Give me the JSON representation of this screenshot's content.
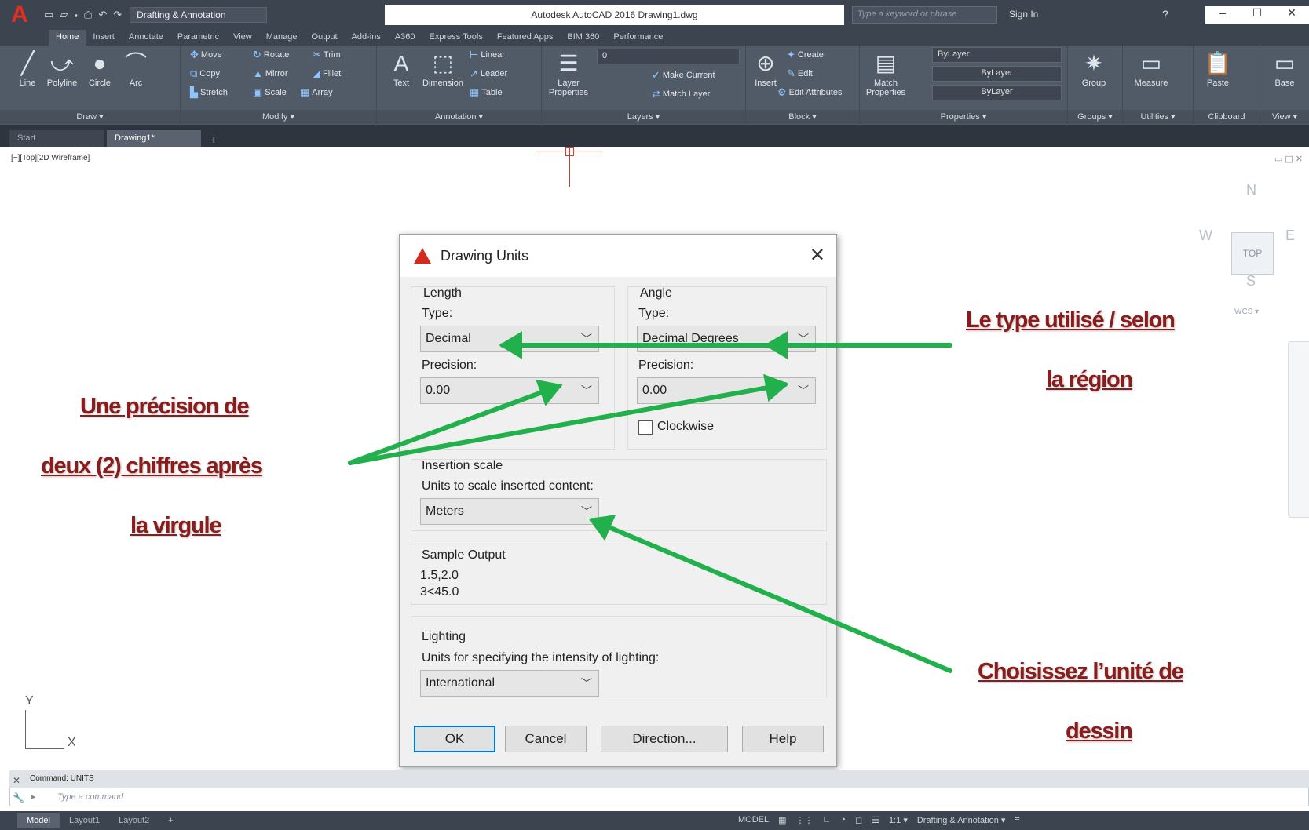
{
  "app": {
    "logo": "A",
    "title": "Autodesk AutoCAD 2016   Drawing1.dwg",
    "workspace": "Drafting & Annotation",
    "search_placeholder": "Type a keyword or phrase",
    "signin": "Sign In",
    "window_controls": [
      "–",
      "☐",
      "✕"
    ]
  },
  "ribbon_tabs": [
    "Home",
    "Insert",
    "Annotate",
    "Parametric",
    "View",
    "Manage",
    "Output",
    "Add-ins",
    "A360",
    "Express Tools",
    "Featured Apps",
    "BIM 360",
    "Performance"
  ],
  "ribbon": {
    "draw": {
      "tools": [
        "Line",
        "Polyline",
        "Circle",
        "Arc"
      ],
      "title": "Draw ▾"
    },
    "modify": {
      "tools": [
        "Move",
        "Rotate",
        "Trim",
        "Copy",
        "Mirror",
        "Fillet",
        "Stretch",
        "Scale",
        "Array"
      ],
      "title": "Modify ▾"
    },
    "annotation": {
      "tools": [
        "Text",
        "Dimension",
        "Linear",
        "Leader",
        "Table"
      ],
      "title": "Annotation ▾"
    },
    "layers": {
      "tools": [
        "Layer Properties",
        "Make Current",
        "Match Layer"
      ],
      "layer_value": "0",
      "title": "Layers ▾"
    },
    "block": {
      "tools": [
        "Insert",
        "Create",
        "Edit",
        "Edit Attributes"
      ],
      "title": "Block ▾"
    },
    "properties": {
      "tools": [
        "Match Properties"
      ],
      "color": "ByLayer",
      "linetype": "ByLayer",
      "lineweight": "ByLayer",
      "title": "Properties ▾"
    },
    "groups": {
      "tools": [
        "Group"
      ],
      "title": "Groups ▾"
    },
    "utilities": {
      "tools": [
        "Measure"
      ],
      "title": "Utilities ▾"
    },
    "clipboard": {
      "tools": [
        "Paste"
      ],
      "title": "Clipboard"
    },
    "view": {
      "tools": [
        "Base"
      ],
      "title": "View ▾"
    }
  },
  "file_tabs": [
    "Start",
    "Drawing1*"
  ],
  "viewport": {
    "label": "[−][Top][2D Wireframe]",
    "viewcube": {
      "top": "TOP",
      "n": "N",
      "s": "S",
      "w": "W",
      "e": "E",
      "wcs": "WCS ▾"
    },
    "ucs": {
      "x": "X",
      "y": "Y"
    }
  },
  "annotations": {
    "left": [
      "Une  précision de",
      "deux  (2) chiffres  après",
      "la virgule"
    ],
    "top_right": [
      "Le type utilisé / selon",
      "la région"
    ],
    "bottom_right": [
      "Choisissez l’unité de",
      "dessin"
    ]
  },
  "dialog": {
    "title": "Drawing Units",
    "close": "✕",
    "length": {
      "group": "Length",
      "type_label": "Type:",
      "type_value": "Decimal",
      "precision_label": "Precision:",
      "precision_value": "0.00"
    },
    "angle": {
      "group": "Angle",
      "type_label": "Type:",
      "type_value": "Decimal Degrees",
      "precision_label": "Precision:",
      "precision_value": "0.00",
      "clockwise_label": "Clockwise",
      "clockwise_checked": false
    },
    "insertion": {
      "group": "Insertion scale",
      "label": "Units to scale inserted content:",
      "value": "Meters"
    },
    "sample": {
      "group": "Sample Output",
      "line1": "1.5,2.0",
      "line2": "3<45.0"
    },
    "lighting": {
      "group": "Lighting",
      "label": "Units for specifying the intensity of lighting:",
      "value": "International"
    },
    "buttons": {
      "ok": "OK",
      "cancel": "Cancel",
      "direction": "Direction...",
      "help": "Help"
    }
  },
  "command": {
    "history": "Command:  UNITS",
    "placeholder": "Type  a  command"
  },
  "status": {
    "layout_tabs": [
      "Model",
      "Layout1",
      "Layout2"
    ],
    "model": "MODEL",
    "scale": "1:1 ▾",
    "workspace": "Drafting & Annotation ▾"
  },
  "colors": {
    "arrow": "#22b04c",
    "annotation_text": "#8a1c1c",
    "ribbon_bg": "#515a67",
    "dialog_bg": "#f0f0f0"
  }
}
